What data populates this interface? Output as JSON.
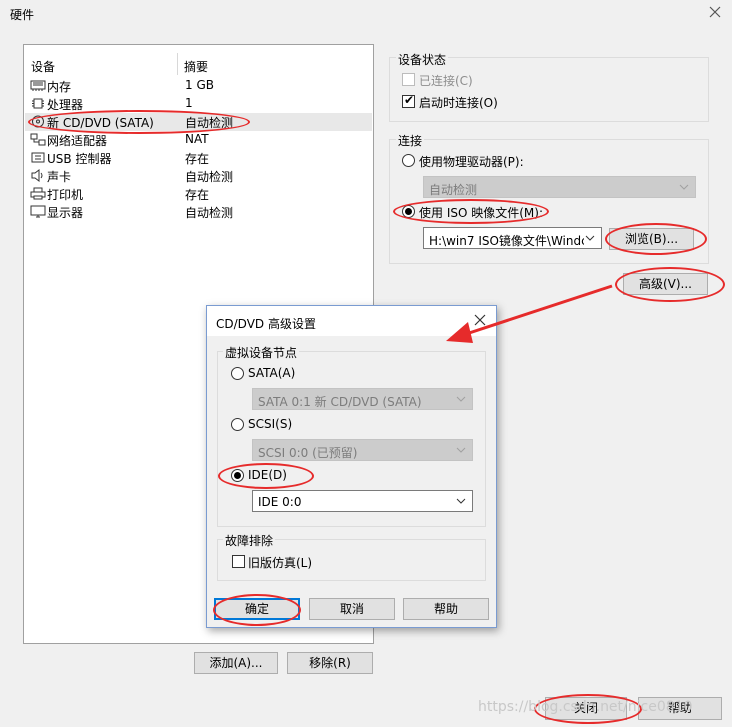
{
  "window": {
    "title": "硬件"
  },
  "device_list": {
    "headers": {
      "device": "设备",
      "summary": "摘要"
    },
    "rows": [
      {
        "icon": "memory-icon",
        "name": "内存",
        "summary": "1 GB"
      },
      {
        "icon": "cpu-icon",
        "name": "处理器",
        "summary": "1"
      },
      {
        "icon": "cd-dvd-icon",
        "name": "新 CD/DVD (SATA)",
        "summary": "自动检测",
        "selected": true
      },
      {
        "icon": "network-adapter-icon",
        "name": "网络适配器",
        "summary": "NAT"
      },
      {
        "icon": "usb-icon",
        "name": "USB 控制器",
        "summary": "存在"
      },
      {
        "icon": "speaker-icon",
        "name": "声卡",
        "summary": "自动检测"
      },
      {
        "icon": "printer-icon",
        "name": "打印机",
        "summary": "存在"
      },
      {
        "icon": "monitor-icon",
        "name": "显示器",
        "summary": "自动检测"
      }
    ],
    "add_button": "添加(A)...",
    "remove_button": "移除(R)"
  },
  "device_status": {
    "title": "设备状态",
    "connected": {
      "label": "已连接(C)",
      "checked": false,
      "disabled": true
    },
    "connect_on_power": {
      "label": "启动时连接(O)",
      "checked": true
    }
  },
  "connection": {
    "title": "连接",
    "physical": {
      "label": "使用物理驱动器(P):",
      "selected": false
    },
    "physical_select": "自动检测",
    "iso": {
      "label": "使用 ISO 映像文件(M):",
      "selected": true
    },
    "iso_path": "H:\\win7 ISO镜像文件\\Windc",
    "browse_button": "浏览(B)...",
    "advanced_button": "高级(V)..."
  },
  "footer": {
    "close_button": "关闭",
    "help_button": "帮助"
  },
  "advanced_dialog": {
    "title": "CD/DVD 高级设置",
    "node_group": "虚拟设备节点",
    "sata": {
      "label": "SATA(A)",
      "selected": false,
      "select": "SATA 0:1   新 CD/DVD (SATA)"
    },
    "scsi": {
      "label": "SCSI(S)",
      "selected": false,
      "select": "SCSI 0:0  (已预留)"
    },
    "ide": {
      "label": "IDE(D)",
      "selected": true,
      "select": "IDE 0:0"
    },
    "troubleshoot_group": "故障排除",
    "legacy": {
      "label": "旧版仿真(L)",
      "checked": false
    },
    "ok_button": "确定",
    "cancel_button": "取消",
    "help_button": "帮助"
  },
  "annotation_color": "#e62b2b",
  "watermark": "https://blog.csdn.net/nice0810"
}
